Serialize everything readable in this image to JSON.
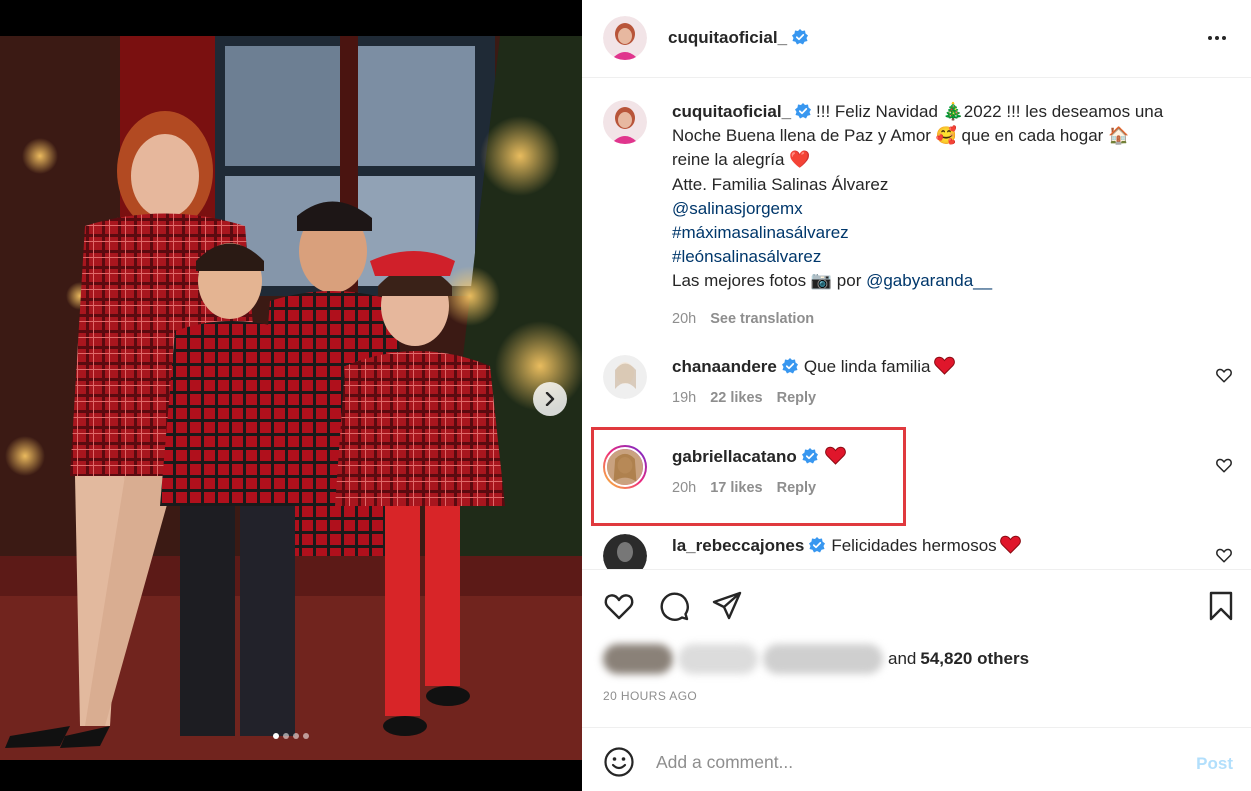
{
  "post": {
    "username": "cuquitaoficial_",
    "caption": {
      "line1": "!!! Feliz Navidad 🎄2022 !!! les deseamos una",
      "line2": "Noche Buena llena de Paz y Amor 🥰 que en cada hogar 🏠",
      "line3": "reine la alegría ❤️",
      "line4": "Atte. Familia Salinas Álvarez",
      "mention1": "@salinasjorgemx",
      "hashtag1": "#máximasalinasálvarez",
      "hashtag2": "#leónsalinasálvarez",
      "line8_prefix": "Las mejores fotos 📷 por ",
      "mention2": "@gabyaranda__",
      "time": "20h",
      "see_translation": "See translation"
    },
    "comments": [
      {
        "username": "chanaandere",
        "text": "Que linda familia",
        "time": "19h",
        "likes": "22 likes",
        "reply": "Reply"
      },
      {
        "username": "gabriellacatano",
        "text": "",
        "time": "20h",
        "likes": "17 likes",
        "reply": "Reply"
      },
      {
        "username": "la_rebeccajones",
        "text": "Felicidades hermosos"
      }
    ],
    "likes_suffix": "and ",
    "likes_others": "54,820 others",
    "timestamp": "20 HOURS AGO",
    "comment_placeholder": "Add a comment...",
    "post_label": "Post"
  },
  "carousel": {
    "total_slides": 4,
    "active_index": 0
  },
  "colors": {
    "verified": "#3897f0",
    "highlight_box": "#e0393e",
    "link": "#00376b",
    "heart": "#e0162b"
  },
  "icons": [
    "verified-badge-icon",
    "more-options-icon",
    "next-arrow-icon",
    "heart-icon",
    "comment-icon",
    "share-icon",
    "bookmark-icon",
    "emoji-icon",
    "small-heart-icon"
  ]
}
